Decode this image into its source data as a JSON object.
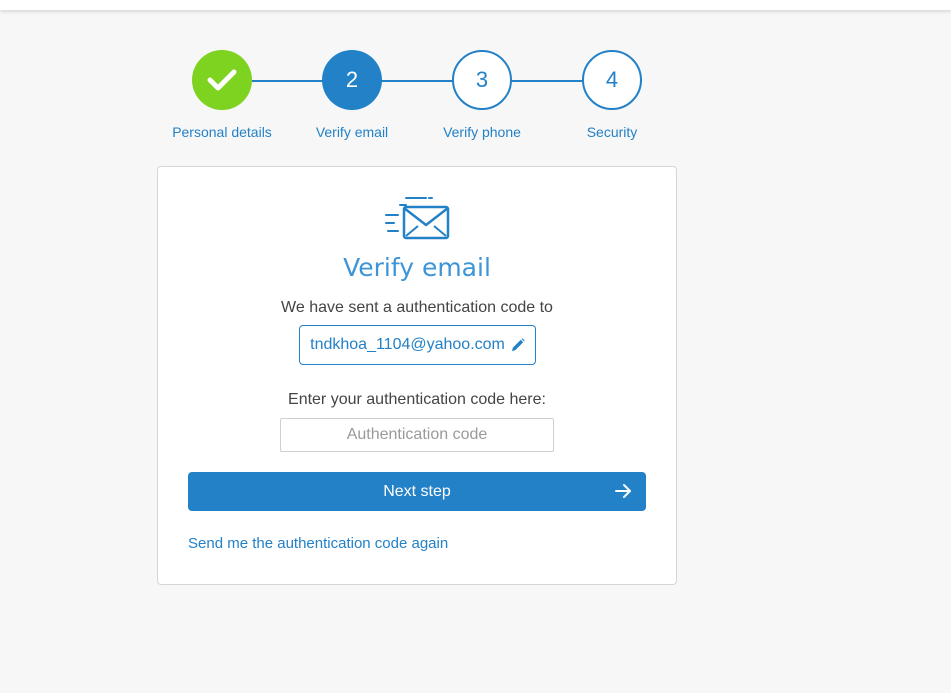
{
  "steps": [
    {
      "label": "Personal details",
      "number": "",
      "state": "done",
      "icon": "checkmark-icon"
    },
    {
      "label": "Verify email",
      "number": "2",
      "state": "active"
    },
    {
      "label": "Verify phone",
      "number": "3",
      "state": "pending"
    },
    {
      "label": "Security",
      "number": "4",
      "state": "pending"
    }
  ],
  "card": {
    "icon": "envelope-icon",
    "title": "Verify email",
    "sent_text": "We have sent a authentication code to",
    "email": "tndkhoa_1104@yahoo.com",
    "edit_icon": "pencil-icon",
    "enter_label": "Enter your authentication code here:",
    "code_placeholder": "Authentication code",
    "code_value": "",
    "next_label": "Next step",
    "next_icon": "arrow-right-icon",
    "resend_label": "Send me the authentication code again"
  },
  "colors": {
    "primary": "#2381c7",
    "done": "#7ed321",
    "background": "#f7f7f7"
  }
}
